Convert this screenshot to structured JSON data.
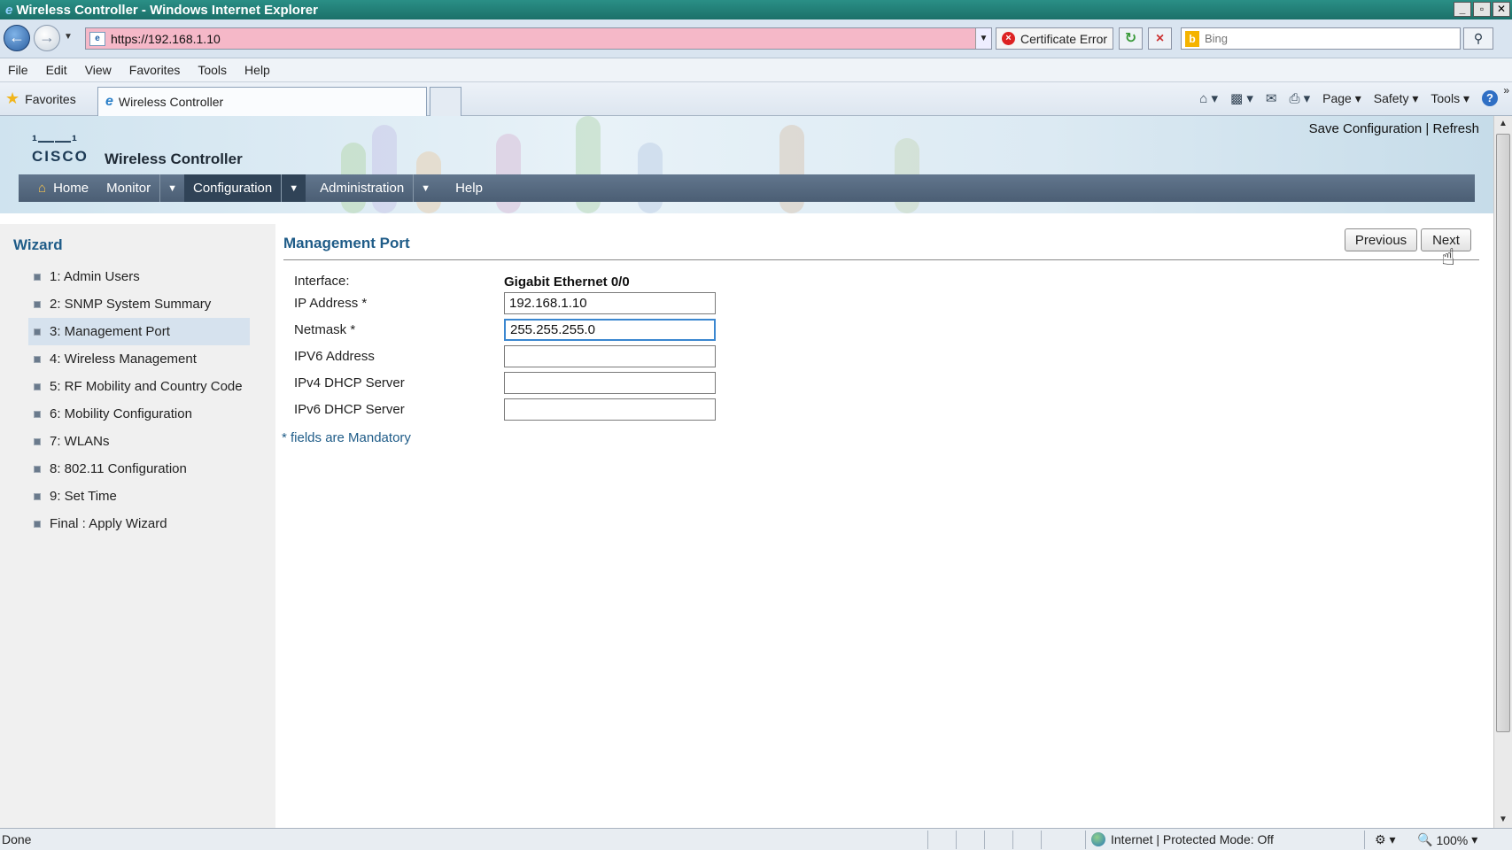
{
  "window": {
    "title": "Wireless Controller - Windows Internet Explorer",
    "controls": [
      "_",
      "▫",
      "✕"
    ]
  },
  "address_bar": {
    "url": "https://192.168.1.10",
    "certificate_error": "Certificate Error",
    "search_placeholder": "Bing",
    "url_background": "#f5b8c8"
  },
  "menu": [
    "File",
    "Edit",
    "View",
    "Favorites",
    "Tools",
    "Help"
  ],
  "favorites_bar": {
    "favorites_label": "Favorites",
    "tab_title": "Wireless Controller",
    "commands": {
      "page": "Page",
      "safety": "Safety",
      "tools": "Tools"
    }
  },
  "header": {
    "product_name": "Wireless Controller",
    "logo_text": "CISCO",
    "save_configuration": "Save Configuration",
    "separator": "|",
    "refresh": "Refresh"
  },
  "main_nav": {
    "home": "Home",
    "monitor": "Monitor",
    "configuration": "Configuration",
    "administration": "Administration",
    "help": "Help"
  },
  "sidebar": {
    "title": "Wizard",
    "steps": [
      "1: Admin Users",
      "2: SNMP System Summary",
      "3: Management Port",
      "4: Wireless Management",
      "5: RF Mobility and Country Code",
      "6: Mobility Configuration",
      "7: WLANs",
      "8: 802.11 Configuration",
      "9: Set Time",
      "Final : Apply Wizard"
    ],
    "active_index": 2
  },
  "content": {
    "title": "Management Port",
    "previous_button": "Previous",
    "next_button": "Next",
    "fields": {
      "interface_label": "Interface:",
      "interface_value": "Gigabit Ethernet 0/0",
      "ip_label": "IP Address *",
      "ip_value": "192.168.1.10",
      "netmask_label": "Netmask *",
      "netmask_value": "255.255.255.0",
      "ipv6_label": "IPV6 Address",
      "ipv6_value": "",
      "ipv4_dhcp_label": "IPv4 DHCP Server",
      "ipv4_dhcp_value": "",
      "ipv6_dhcp_label": "IPv6 DHCP Server",
      "ipv6_dhcp_value": ""
    },
    "mandatory_note": "* fields are Mandatory"
  },
  "status_bar": {
    "status": "Done",
    "zone": "Internet | Protected Mode: Off",
    "zoom": "100%"
  },
  "colors": {
    "accent": "#1f5c88",
    "nav_bar": "#4b5e74",
    "nav_active": "#304357"
  }
}
